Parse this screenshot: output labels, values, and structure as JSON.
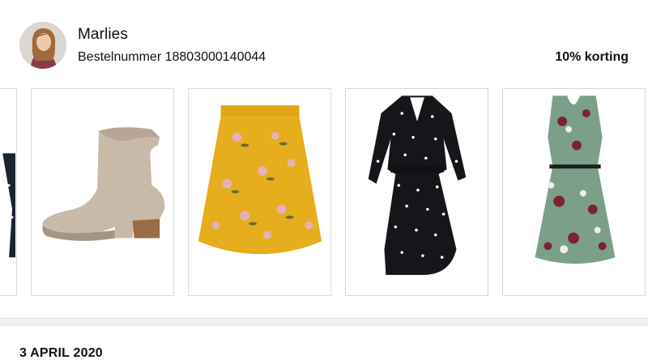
{
  "customer": {
    "name": "Marlies",
    "order_label": "Bestelnummer 18803000140044",
    "discount": "10% korting"
  },
  "products": [
    {
      "name": "partial-dress",
      "icon": "dress-icon"
    },
    {
      "name": "suede-ankle-boot",
      "icon": "boot-icon"
    },
    {
      "name": "yellow-floral-skirt",
      "icon": "skirt-icon"
    },
    {
      "name": "black-polka-dot-wrap-dress",
      "icon": "dress-icon"
    },
    {
      "name": "green-floral-dress",
      "icon": "dress-icon"
    }
  ],
  "section": {
    "date": "3 APRIL 2020"
  },
  "colors": {
    "text": "#111111",
    "card_border": "#d8d8d8",
    "divider": "#f1f1f1"
  }
}
